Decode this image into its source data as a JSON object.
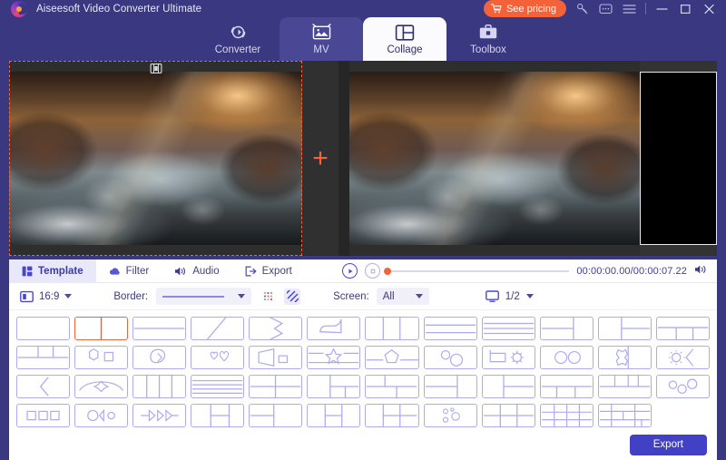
{
  "window": {
    "app_title": "Aiseesoft Video Converter Ultimate",
    "logo_icon": "aiseesoft-logo-icon",
    "pricing_label": "See pricing",
    "pricing_icon": "cart-icon",
    "pricing_color": "#f4623a",
    "key_icon": "key-icon",
    "feedback_icon": "feedback-icon",
    "menu_icon": "hamburger-menu-icon",
    "minimize_icon": "minimize-icon",
    "maximize_icon": "maximize-icon",
    "close_icon": "close-icon"
  },
  "nav": {
    "tabs": [
      {
        "label": "Converter",
        "icon": "converter-icon",
        "state": "normal"
      },
      {
        "label": "MV",
        "icon": "mv-icon",
        "state": "semi"
      },
      {
        "label": "Collage",
        "icon": "collage-icon",
        "state": "active"
      },
      {
        "label": "Toolbox",
        "icon": "toolbox-icon",
        "state": "normal"
      }
    ]
  },
  "preview": {
    "add_media_icon": "plus-icon",
    "clip_badge_icon": "film-clip-icon",
    "selection_color": "#f4623a"
  },
  "panel_tabs": [
    {
      "label": "Template",
      "icon": "template-icon",
      "active": true
    },
    {
      "label": "Filter",
      "icon": "filter-cloud-icon",
      "active": false
    },
    {
      "label": "Audio",
      "icon": "audio-speaker-icon",
      "active": false
    },
    {
      "label": "Export",
      "icon": "export-arrow-icon",
      "active": false
    }
  ],
  "player": {
    "play_icon": "play-icon",
    "stop_icon": "stop-icon",
    "volume_icon": "volume-icon",
    "current_time": "00:00:00.00",
    "total_time": "00:00:07.22",
    "time_display": "00:00:00.00/00:00:07.22",
    "progress_percent": 0
  },
  "options": {
    "ratio_icon": "aspect-ratio-icon",
    "ratio_value": "16:9",
    "border_label": "Border:",
    "border_style": "solid-line",
    "border_pattern_icon": "dotted-pattern-icon",
    "border_stripe_icon": "diagonal-stripes-icon",
    "screen_label": "Screen:",
    "screen_value": "All",
    "monitor_icon": "monitor-icon",
    "page_value": "1/2"
  },
  "templates": {
    "selected_index": 1,
    "items": [
      {
        "name": "single-pane"
      },
      {
        "name": "two-column"
      },
      {
        "name": "top-bottom-split"
      },
      {
        "name": "diagonal-split"
      },
      {
        "name": "arrow-notch"
      },
      {
        "name": "rounded-shape"
      },
      {
        "name": "three-column"
      },
      {
        "name": "three-row"
      },
      {
        "name": "four-row"
      },
      {
        "name": "left-big-right-stack"
      },
      {
        "name": "left-pane-right-stack"
      },
      {
        "name": "bottom-split-three"
      },
      {
        "name": "top-split-three"
      },
      {
        "name": "hexagon-square"
      },
      {
        "name": "leaf-shape"
      },
      {
        "name": "two-hearts"
      },
      {
        "name": "trapezoid-square"
      },
      {
        "name": "star-band"
      },
      {
        "name": "pentagon-center"
      },
      {
        "name": "circles-duo"
      },
      {
        "name": "flag-gear"
      },
      {
        "name": "two-circles"
      },
      {
        "name": "puzzle-piece"
      },
      {
        "name": "gear-arrow"
      },
      {
        "name": "arrow-left"
      },
      {
        "name": "bowl-diamond"
      },
      {
        "name": "four-column"
      },
      {
        "name": "five-row"
      },
      {
        "name": "quad-grid"
      },
      {
        "name": "left-half-right-quad"
      },
      {
        "name": "top-left-t-split"
      },
      {
        "name": "two-row-right-pane"
      },
      {
        "name": "left-pane-right-split"
      },
      {
        "name": "bottom-three-split"
      },
      {
        "name": "top-three-split"
      },
      {
        "name": "three-circles"
      },
      {
        "name": "three-boxes"
      },
      {
        "name": "circle-wedge-dot"
      },
      {
        "name": "triple-arrow"
      },
      {
        "name": "left-split-right-pair"
      },
      {
        "name": "right-split-column"
      },
      {
        "name": "six-grid-right-pane"
      },
      {
        "name": "six-cell-grid"
      },
      {
        "name": "bubbles-scatter"
      },
      {
        "name": "six-grid-even"
      },
      {
        "name": "nine-grid"
      },
      {
        "name": "mixed-grid"
      }
    ]
  },
  "footer": {
    "export_label": "Export",
    "export_color": "#4240c4"
  }
}
